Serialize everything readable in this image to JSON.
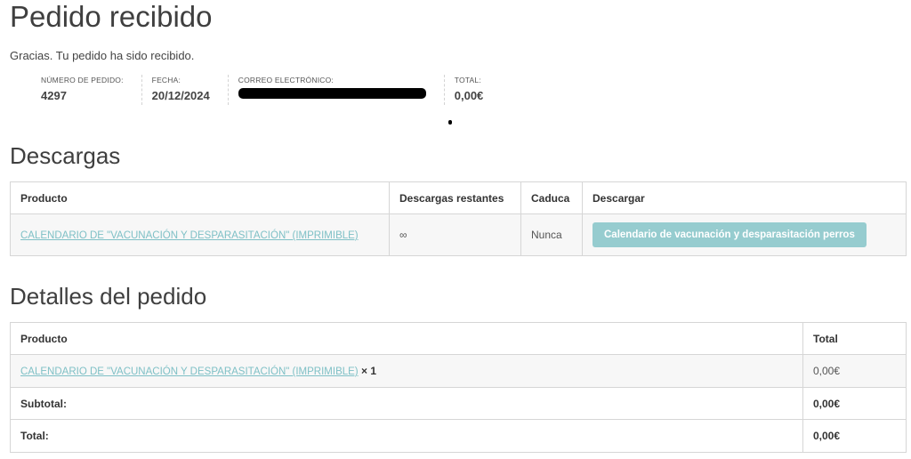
{
  "page_title": "Pedido recibido",
  "thanks_message": "Gracias. Tu pedido ha sido recibido.",
  "overview": {
    "order_number_label": "NÚMERO DE PEDIDO:",
    "order_number": "4297",
    "date_label": "FECHA:",
    "date": "20/12/2024",
    "email_label": "CORREO ELECTRÓNICO:",
    "total_label": "TOTAL:",
    "total": "0,00€"
  },
  "downloads": {
    "heading": "Descargas",
    "columns": [
      "Producto",
      "Descargas restantes",
      "Caduca",
      "Descargar"
    ],
    "rows": [
      {
        "product": "CALENDARIO DE \"VACUNACIÓN Y DESPARASITACIÓN\" (IMPRIMIBLE)",
        "remaining": "∞",
        "expires": "Nunca",
        "download_label": "Calendario de vacunación y desparasitación perros"
      }
    ]
  },
  "order_details": {
    "heading": "Detalles del pedido",
    "columns": [
      "Producto",
      "Total"
    ],
    "item": {
      "product": "CALENDARIO DE \"VACUNACIÓN Y DESPARASITACIÓN\" (IMPRIMIBLE)",
      "quantity": "× 1",
      "total": "0,00€"
    },
    "subtotal_label": "Subtotal:",
    "subtotal": "0,00€",
    "total_label": "Total:",
    "total": "0,00€"
  }
}
